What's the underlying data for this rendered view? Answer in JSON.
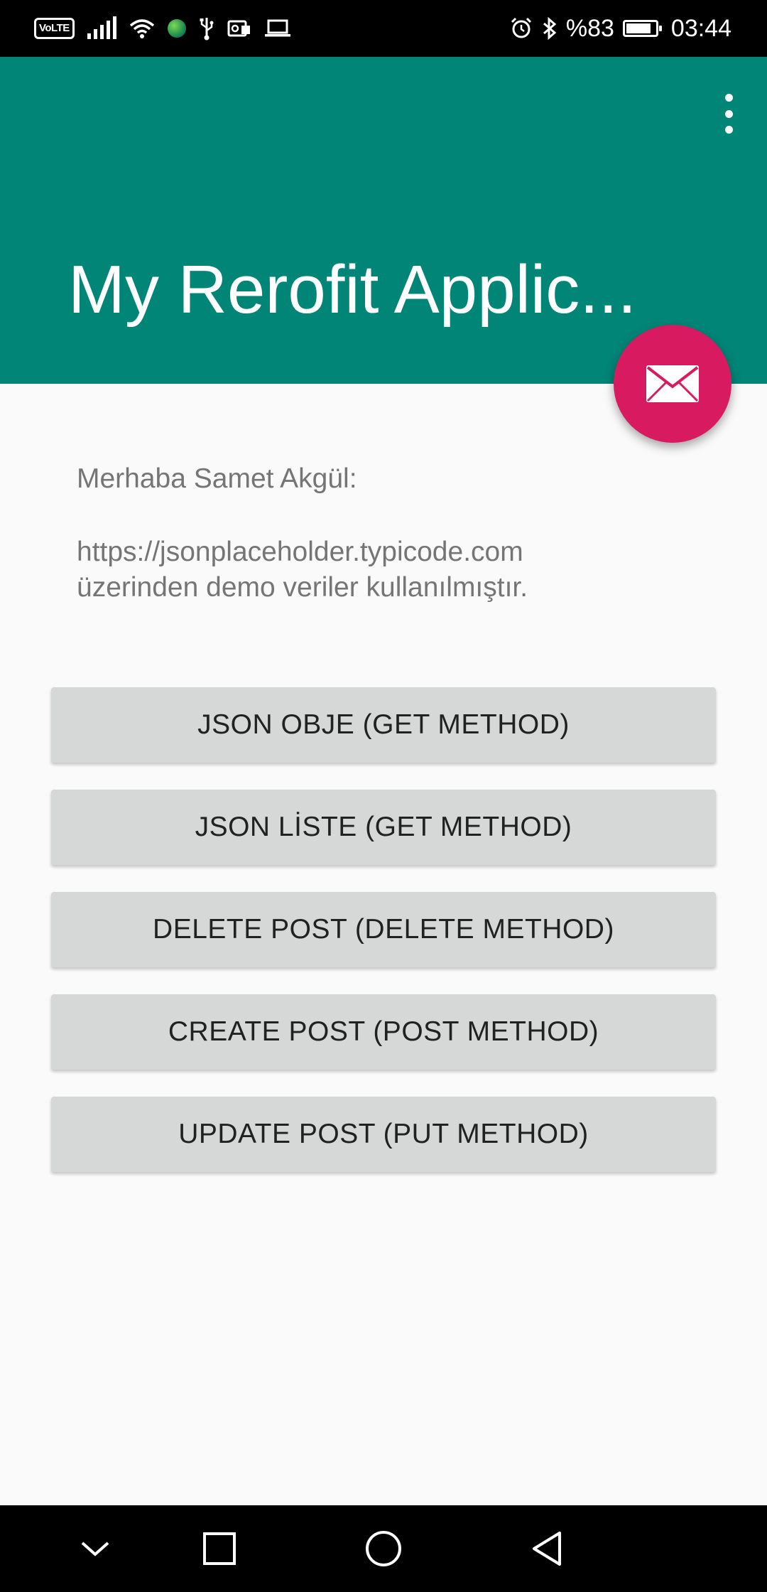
{
  "status_bar": {
    "left_icons": [
      "volte-icon",
      "signal-icon",
      "wifi-icon",
      "globe-icon",
      "usb-icon",
      "vpn-icon",
      "laptop-icon"
    ],
    "volte_label": "VoLTE",
    "battery_percent": "%83",
    "time": "03:44"
  },
  "app_bar": {
    "title": "My Rerofit Applic...",
    "overflow_icon": "more-vert-icon"
  },
  "fab": {
    "icon": "mail-icon",
    "color": "#d81b60"
  },
  "content": {
    "greeting": "Merhaba Samet Akgül:",
    "info_line1": "https://jsonplaceholder.typicode.com",
    "info_line2": "üzerinden demo veriler kullanılmıştır."
  },
  "buttons": [
    {
      "label": "JSON OBJE (GET METHOD)"
    },
    {
      "label": "JSON LİSTE (GET METHOD)"
    },
    {
      "label": "DELETE POST (DELETE METHOD)"
    },
    {
      "label": "CREATE POST (POST METHOD)"
    },
    {
      "label": "UPDATE POST (PUT METHOD)"
    }
  ],
  "nav_bar": {
    "items": [
      "chevron-down-icon",
      "recents-icon",
      "home-icon",
      "back-icon"
    ]
  },
  "colors": {
    "primary": "#008577",
    "accent": "#d81b60",
    "button_bg": "#d6d7d7",
    "background": "#fafafa"
  }
}
